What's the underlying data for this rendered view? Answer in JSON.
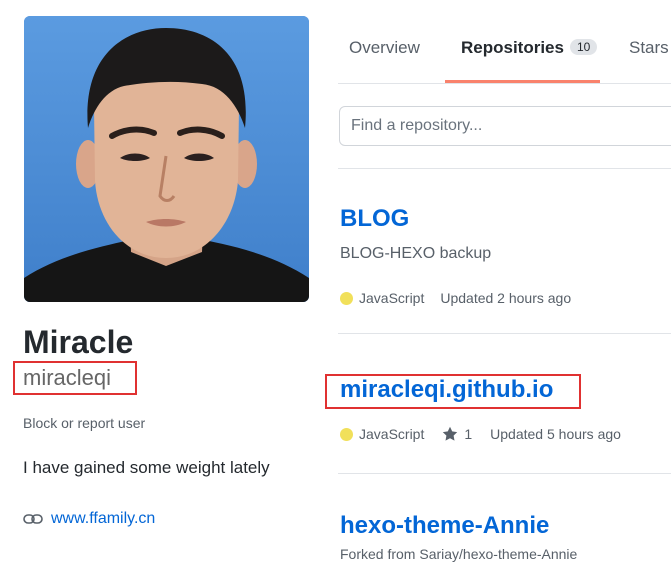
{
  "profile": {
    "full_name": "Miracle",
    "username": "miracleqi",
    "block_link": "Block or report user",
    "bio": "I have gained some weight lately",
    "website": "www.ffamily.cn"
  },
  "tabs": [
    {
      "label": "Overview"
    },
    {
      "label": "Repositories",
      "count": "10"
    },
    {
      "label": "Stars"
    }
  ],
  "search": {
    "placeholder": "Find a repository..."
  },
  "repos": [
    {
      "name": "BLOG",
      "description": "BLOG-HEXO backup",
      "language": "JavaScript",
      "updated": "Updated 2 hours ago"
    },
    {
      "name": "miracleqi.github.io",
      "language": "JavaScript",
      "stars": "1",
      "updated": "Updated 5 hours ago"
    },
    {
      "name": "hexo-theme-Annie",
      "description": "Forked from Sariay/hexo-theme-Annie"
    }
  ],
  "colors": {
    "accent": "#0366d6",
    "tab_underline": "#f9826c",
    "javascript": "#f1e05a",
    "highlight_box": "#e03131"
  },
  "icons": {
    "avatar": "profile-photo",
    "website": "link-icon",
    "star": "star-icon"
  }
}
